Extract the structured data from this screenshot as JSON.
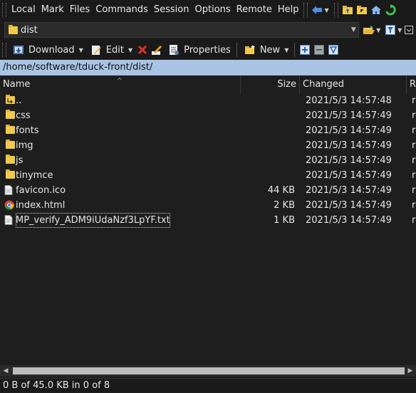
{
  "menubar": {
    "items": [
      "Local",
      "Mark",
      "Files",
      "Commands",
      "Session",
      "Options",
      "Remote",
      "Help"
    ]
  },
  "pathbar": {
    "current_dir": "dist"
  },
  "toolbar": {
    "download": "Download",
    "edit": "Edit",
    "properties": "Properties",
    "new": "New"
  },
  "address": {
    "path": "/home/software/tduck-front/dist/"
  },
  "columns": {
    "name": "Name",
    "size": "Size",
    "changed": "Changed",
    "rights": "R"
  },
  "files": [
    {
      "name": "..",
      "size": "",
      "changed": "2021/5/3 14:57:48",
      "type": "parent",
      "ext": "r"
    },
    {
      "name": "css",
      "size": "",
      "changed": "2021/5/3 14:57:49",
      "type": "folder",
      "ext": "r"
    },
    {
      "name": "fonts",
      "size": "",
      "changed": "2021/5/3 14:57:49",
      "type": "folder",
      "ext": "r"
    },
    {
      "name": "img",
      "size": "",
      "changed": "2021/5/3 14:57:49",
      "type": "folder",
      "ext": "r"
    },
    {
      "name": "js",
      "size": "",
      "changed": "2021/5/3 14:57:49",
      "type": "folder",
      "ext": "r"
    },
    {
      "name": "tinymce",
      "size": "",
      "changed": "2021/5/3 14:57:49",
      "type": "folder",
      "ext": "r"
    },
    {
      "name": "favicon.ico",
      "size": "44 KB",
      "changed": "2021/5/3 14:57:49",
      "type": "file",
      "ext": "r"
    },
    {
      "name": "index.html",
      "size": "2 KB",
      "changed": "2021/5/3 14:57:49",
      "type": "html",
      "ext": "r"
    },
    {
      "name": "MP_verify_ADM9iUdaNzf3LpYF.txt",
      "size": "1 KB",
      "changed": "2021/5/3 14:57:49",
      "type": "file",
      "ext": "r"
    }
  ],
  "status": {
    "text": "0 B of 45.0 KB in 0 of 8"
  },
  "colors": {
    "address_bg": "#a9c4e4",
    "folder": "#f2c94c"
  }
}
